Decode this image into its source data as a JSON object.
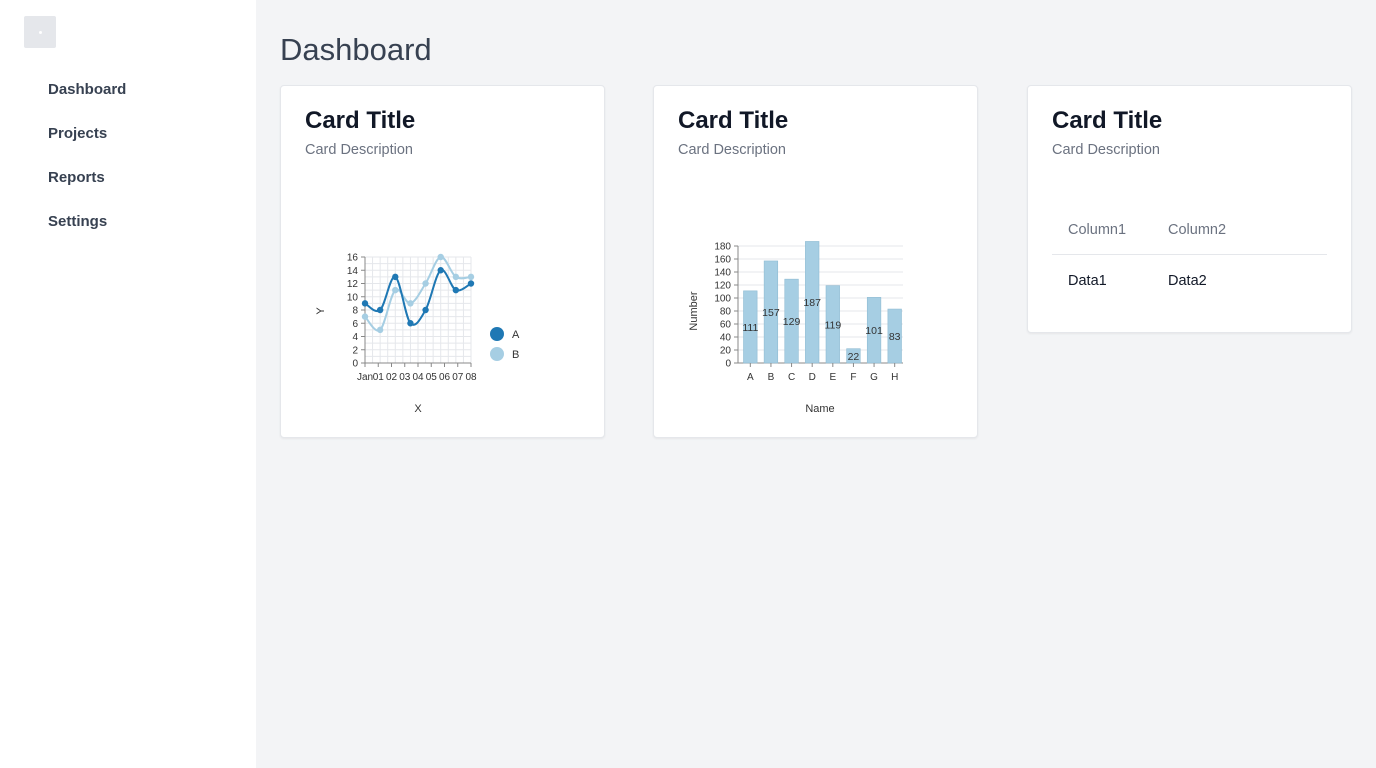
{
  "sidebar": {
    "items": [
      {
        "label": "Dashboard"
      },
      {
        "label": "Projects"
      },
      {
        "label": "Reports"
      },
      {
        "label": "Settings"
      }
    ]
  },
  "page": {
    "title": "Dashboard"
  },
  "cards": [
    {
      "title": "Card Title",
      "description": "Card Description"
    },
    {
      "title": "Card Title",
      "description": "Card Description"
    },
    {
      "title": "Card Title",
      "description": "Card Description"
    }
  ],
  "table": {
    "headers": [
      "Column1",
      "Column2"
    ],
    "rows": [
      [
        "Data1",
        "Data2"
      ]
    ]
  },
  "chart_data": [
    {
      "type": "line",
      "xlabel": "X",
      "ylabel": "Y",
      "ylim": [
        0,
        16
      ],
      "yticks": [
        0,
        2,
        4,
        6,
        8,
        10,
        12,
        14,
        16
      ],
      "x_tick_labels": [
        "Jan",
        "01",
        "02",
        "03",
        "04",
        "05",
        "06",
        "07",
        "08"
      ],
      "grid": true,
      "legend_position": "right",
      "series": [
        {
          "name": "A",
          "color": "#1f78b4",
          "values": [
            9,
            8,
            13,
            6,
            8,
            14,
            11,
            12
          ]
        },
        {
          "name": "B",
          "color": "#a6cee3",
          "values": [
            7,
            5,
            11,
            9,
            12,
            16,
            13,
            13
          ]
        }
      ]
    },
    {
      "type": "bar",
      "xlabel": "Name",
      "ylabel": "Number",
      "ylim": [
        0,
        180
      ],
      "yticks": [
        0,
        20,
        40,
        60,
        80,
        100,
        120,
        140,
        160,
        180
      ],
      "grid": true,
      "color": "#a6cee3",
      "categories": [
        "A",
        "B",
        "C",
        "D",
        "E",
        "F",
        "G",
        "H"
      ],
      "values": [
        111,
        157,
        129,
        187,
        119,
        22,
        101,
        83
      ]
    }
  ]
}
